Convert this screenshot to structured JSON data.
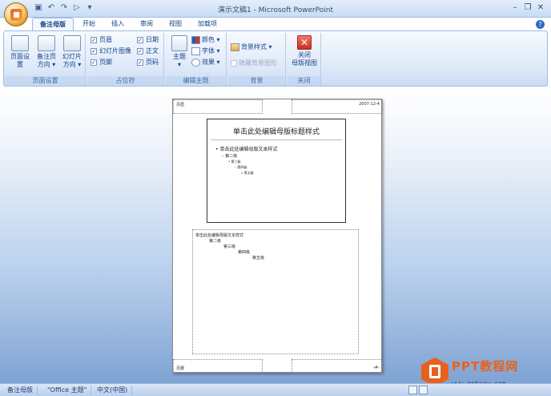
{
  "app": {
    "window_title": "演示文稿1 - Microsoft PowerPoint"
  },
  "window_controls": {
    "minimize": "–",
    "restore": "❐",
    "close": "✕"
  },
  "tabs": [
    {
      "label": "备注母版",
      "active": true
    },
    {
      "label": "开始"
    },
    {
      "label": "插入"
    },
    {
      "label": "审阅"
    },
    {
      "label": "视图"
    },
    {
      "label": "加载项"
    }
  ],
  "ribbon": {
    "page_setup": {
      "label": "页面设置",
      "btn1": "页面设置",
      "btn2_line1": "备注页",
      "btn2_line2": "方向 ▾",
      "btn3_line1": "幻灯片",
      "btn3_line2": "方向 ▾"
    },
    "placeholders": {
      "label": "占位符",
      "items": [
        "页眉",
        "幻灯片图像",
        "页脚",
        "日期",
        "正文",
        "页码"
      ]
    },
    "edit_theme": {
      "label": "编辑主题",
      "theme_btn": "主题",
      "colors": "颜色 ▾",
      "fonts": "字体 ▾",
      "effects": "效果 ▾"
    },
    "background": {
      "label": "背景",
      "styles": "背景样式 ▾",
      "hide_graphics": "隐藏背景图形"
    },
    "close": {
      "label": "关闭",
      "btn_line1": "关闭",
      "btn_line2": "母版视图"
    }
  },
  "notes_page": {
    "header": "页眉",
    "date": "2007-12-4",
    "slide_title": "单击此处编辑母版标题样式",
    "slide_levels": [
      "• 单击此处编辑母版文本样式",
      "– 第二级",
      "• 第三级",
      "– 第四级",
      "» 第五级"
    ],
    "notes_levels": [
      "单击此处编辑母版文本样式",
      "第二级",
      "第三级",
      "第四级",
      "第五级"
    ],
    "footer": "页脚",
    "page_num": "‹#›"
  },
  "status_bar": {
    "view": "备注母版",
    "theme": "\"Office 主题\"",
    "language": "中文(中国)"
  },
  "watermark": {
    "text": "PPT教程网",
    "url": "www.pptxxw.com"
  },
  "colors": {
    "accent": "#e8611c",
    "ribbon_text": "#15428b"
  }
}
